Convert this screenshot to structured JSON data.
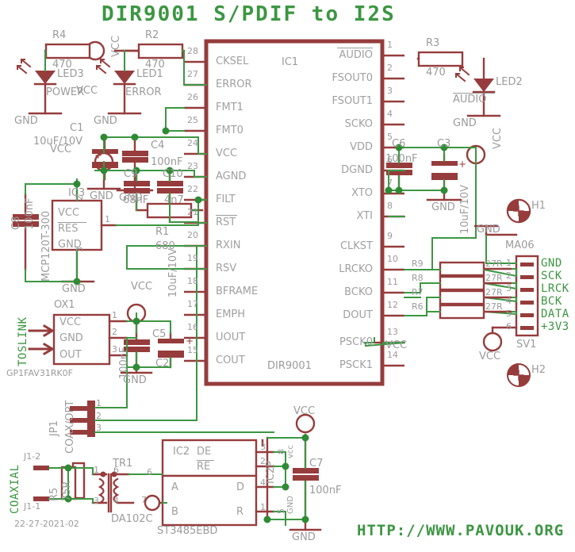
{
  "sheet": {
    "title": "DIR9001 S/PDIF to I2S",
    "url": "HTTP://WWW.PAVOUK.ORG",
    "revision": "22-27-2021-02",
    "colors": {
      "wire": "#963c3c",
      "net": "#3c9642",
      "text": "#9b9b9b",
      "green_text": "#3c9642"
    }
  },
  "main_ic": {
    "ref": "IC1",
    "device": "DIR9001",
    "left_pins": [
      {
        "num": "28",
        "name": "CKSEL",
        "overline": false
      },
      {
        "num": "27",
        "name": "ERROR",
        "overline": false
      },
      {
        "num": "26",
        "name": "FMT1",
        "overline": false
      },
      {
        "num": "25",
        "name": "FMT0",
        "overline": false
      },
      {
        "num": "24",
        "name": "VCC",
        "overline": false
      },
      {
        "num": "23",
        "name": "AGND",
        "overline": false
      },
      {
        "num": "22",
        "name": "FILT",
        "overline": false
      },
      {
        "num": "21",
        "name": "RST",
        "overline": true
      },
      {
        "num": "20",
        "name": "RXIN",
        "overline": false
      },
      {
        "num": "19",
        "name": "RSV",
        "overline": false
      },
      {
        "num": "18",
        "name": "BFRAME",
        "overline": false
      },
      {
        "num": "17",
        "name": "EMPH",
        "overline": false
      },
      {
        "num": "16",
        "name": "UOUT",
        "overline": false
      },
      {
        "num": "15",
        "name": "COUT",
        "overline": false
      }
    ],
    "right_pins": [
      {
        "num": "1",
        "name": "AUDIO",
        "overline": true
      },
      {
        "num": "2",
        "name": "FSOUT0",
        "overline": false
      },
      {
        "num": "3",
        "name": "FSOUT1",
        "overline": false
      },
      {
        "num": "4",
        "name": "SCKO",
        "overline": false
      },
      {
        "num": "5",
        "name": "VDD",
        "overline": false
      },
      {
        "num": "6",
        "name": "DGND",
        "overline": false
      },
      {
        "num": "7",
        "name": "XTO",
        "overline": false
      },
      {
        "num": "8",
        "name": "XTI",
        "overline": false
      },
      {
        "num": "9",
        "name": "CLKST",
        "overline": false
      },
      {
        "num": "10",
        "name": "LRCKO",
        "overline": false
      },
      {
        "num": "11",
        "name": "BCKO",
        "overline": false
      },
      {
        "num": "12",
        "name": "DOUT",
        "overline": false
      },
      {
        "num": "13",
        "name": "PSCK0",
        "overline": false
      },
      {
        "num": "14",
        "name": "PSCK1",
        "overline": false
      }
    ]
  },
  "leds": [
    {
      "ref": "LED3",
      "label": "POWER",
      "gnd": "GND"
    },
    {
      "ref": "LED1",
      "label": "ERROR",
      "gnd": "GND"
    },
    {
      "ref": "LED2",
      "label": "AUDIO",
      "label_overline": true,
      "gnd": "GND"
    }
  ],
  "resistors": [
    {
      "ref": "R4",
      "value": "470"
    },
    {
      "ref": "R2",
      "value": "470"
    },
    {
      "ref": "R3",
      "value": "470"
    },
    {
      "ref": "R1",
      "value": "680"
    },
    {
      "ref": "R9",
      "value": "27R"
    },
    {
      "ref": "R8",
      "value": "27R"
    },
    {
      "ref": "R7",
      "value": "27R"
    },
    {
      "ref": "R6",
      "value": "27R"
    },
    {
      "ref": "R5",
      "value": "75R"
    }
  ],
  "capacitors": [
    {
      "ref": "C1",
      "value": "10uF/10V",
      "polarized": true
    },
    {
      "ref": "C4",
      "value": "100nF",
      "polarized": false
    },
    {
      "ref": "C9",
      "value": "68nF",
      "polarized": false
    },
    {
      "ref": "C10",
      "value": "4n7",
      "polarized": false
    },
    {
      "ref": "C8",
      "value": "100nF",
      "polarized": false
    },
    {
      "ref": "C5",
      "value": "100nF",
      "polarized": false
    },
    {
      "ref": "C2",
      "value": "10uF/10V",
      "polarized": true
    },
    {
      "ref": "C6",
      "value": "100nF",
      "polarized": false
    },
    {
      "ref": "C3",
      "value": "10uF/10V",
      "polarized": true
    },
    {
      "ref": "C7",
      "value": "100nF",
      "polarized": false
    }
  ],
  "regulator": {
    "ref": "IC3",
    "device": "MCP120T-300",
    "pins": [
      "VCC",
      "RES",
      "GND"
    ],
    "pin_nums": [
      "2",
      "1",
      "3"
    ]
  },
  "optical": {
    "ref": "OX1",
    "device": "GP1FAV31RK0F",
    "net": "TOSLINK",
    "pins": [
      "VCC",
      "GND",
      "OUT"
    ],
    "pin_nums": [
      "1",
      "2",
      "3"
    ]
  },
  "jumper": {
    "ref": "JP1",
    "label": "COAX/OPT",
    "pin_nums": [
      "1",
      "2",
      "3"
    ]
  },
  "coax": {
    "net": "COAXIAL",
    "j_top": "J1-2",
    "j_bottom": "J1-1"
  },
  "transformer": {
    "ref": "TR1",
    "device": "DA102C",
    "pin_nums": [
      "1",
      "6",
      "3",
      "4"
    ]
  },
  "rs485": {
    "ref": "IC2",
    "device": "ST3485EBD",
    "power_ref": "IC2P",
    "top_pins": [
      {
        "name": "DE",
        "num": "3",
        "overline": false
      },
      {
        "name": "RE",
        "num": "2",
        "overline": true
      }
    ],
    "body_pins": [
      {
        "name": "A",
        "num": "6"
      },
      {
        "name": "B",
        "num": "7"
      },
      {
        "name": "D",
        "num": "4"
      },
      {
        "name": "R",
        "num": "1"
      }
    ],
    "power_pins": [
      {
        "name": "vcc",
        "num": "8"
      },
      {
        "name": "GND",
        "num": "5"
      }
    ]
  },
  "connector": {
    "ref": "SV1",
    "device": "MA06",
    "pin_nums": [
      "1",
      "2",
      "3",
      "4",
      "5",
      "6"
    ],
    "signals": [
      "GND",
      "SCK",
      "LRCK",
      "BCK",
      "DATA",
      "+3V3"
    ],
    "gnd_label": "GND",
    "vcc_label": "VCC"
  },
  "mount_holes": [
    {
      "ref": "H1"
    },
    {
      "ref": "H2"
    }
  ],
  "power_symbols": {
    "vcc": "VCC",
    "gnd": "GND"
  },
  "gnd_labels": [
    "GND",
    "GND",
    "GND",
    "GND",
    "GND",
    "GND",
    "GND",
    "GND"
  ],
  "vcc_labels": [
    "VCC",
    "VCC",
    "VCC",
    "VCC",
    "VCC",
    "VCC",
    "VCC"
  ]
}
